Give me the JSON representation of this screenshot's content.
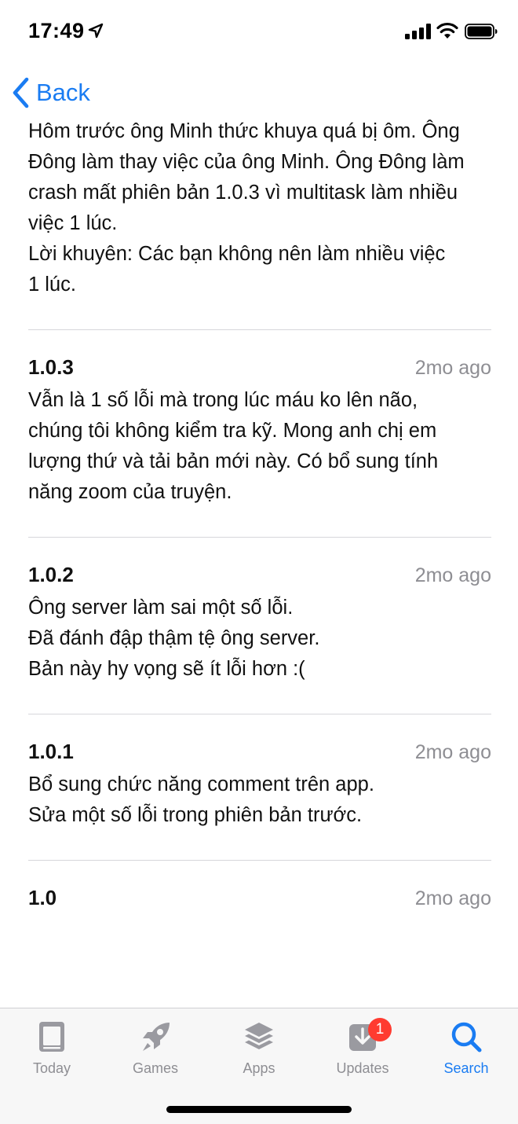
{
  "status_bar": {
    "time": "17:49"
  },
  "nav": {
    "back_label": "Back"
  },
  "intro_note": "Hôm trước ông Minh thức khuya quá bị ôm. Ông\nĐông làm thay việc của ông Minh. Ông Đông làm\ncrash mất phiên bản 1.0.3 vì multitask làm nhiều\nviệc 1 lúc.\nLời khuyên: Các bạn không nên làm nhiều việc\n1 lúc.",
  "versions": [
    {
      "number": "1.0.3",
      "date": "2mo ago",
      "notes": "Vẫn là 1 số lỗi mà trong lúc máu ko lên não,\nchúng tôi không kiểm tra kỹ. Mong anh chị em\nlượng thứ và tải bản mới này. Có bổ sung tính\nnăng zoom của truyện."
    },
    {
      "number": "1.0.2",
      "date": "2mo ago",
      "notes": "Ông server làm sai một số lỗi.\nĐã đánh đập thậm tệ ông server.\nBản này hy vọng sẽ ít lỗi hơn :("
    },
    {
      "number": "1.0.1",
      "date": "2mo ago",
      "notes": "Bổ sung chức năng comment trên app.\nSửa một số lỗi trong phiên bản trước."
    },
    {
      "number": "1.0",
      "date": "2mo ago",
      "notes": ""
    }
  ],
  "tab_bar": {
    "tabs": [
      {
        "label": "Today",
        "icon": "today-icon"
      },
      {
        "label": "Games",
        "icon": "rocket-icon"
      },
      {
        "label": "Apps",
        "icon": "layers-icon"
      },
      {
        "label": "Updates",
        "icon": "download-icon",
        "badge": "1"
      },
      {
        "label": "Search",
        "icon": "search-icon",
        "active": true
      }
    ]
  },
  "colors": {
    "accent": "#1a7cf2",
    "inactive": "#8e8e93",
    "badge": "#ff3b30"
  }
}
